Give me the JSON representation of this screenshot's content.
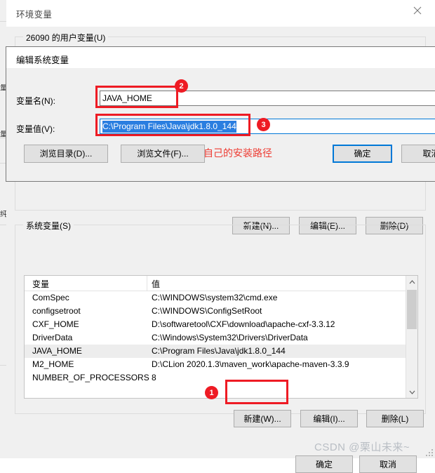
{
  "window": {
    "title": "环境变量",
    "close_icon": "close-icon"
  },
  "user_section": {
    "legend": "26090 的用户变量(U)",
    "buttons": {
      "new": "新建(N)...",
      "edit": "编辑(E)...",
      "delete": "删除(D)"
    }
  },
  "system_section": {
    "legend": "系统变量(S)",
    "columns": [
      "变量",
      "值"
    ],
    "rows": [
      {
        "name": "ComSpec",
        "value": "C:\\WINDOWS\\system32\\cmd.exe",
        "selected": false
      },
      {
        "name": "configsetroot",
        "value": "C:\\WINDOWS\\ConfigSetRoot",
        "selected": false
      },
      {
        "name": "CXF_HOME",
        "value": "D:\\softwaretool\\CXF\\download\\apache-cxf-3.3.12",
        "selected": false
      },
      {
        "name": "DriverData",
        "value": "C:\\Windows\\System32\\Drivers\\DriverData",
        "selected": false
      },
      {
        "name": "JAVA_HOME",
        "value": "C:\\Program Files\\Java\\jdk1.8.0_144",
        "selected": true
      },
      {
        "name": "M2_HOME",
        "value": "D:\\CLion 2020.1.3\\maven_work\\apache-maven-3.3.9",
        "selected": false
      },
      {
        "name": "NUMBER_OF_PROCESSORS",
        "value": "8",
        "selected": false
      }
    ],
    "buttons": {
      "new": "新建(W)...",
      "edit": "编辑(I)...",
      "delete": "删除(L)"
    },
    "scrollbar": {
      "up_icon": "chevron-up-icon",
      "down_icon": "chevron-down-icon"
    }
  },
  "window_buttons": {
    "ok": "确定",
    "cancel": "取消"
  },
  "edit_dialog": {
    "title": "编辑系统变量",
    "name_label": "变量名(N):",
    "name_value": "JAVA_HOME",
    "value_label": "变量值(V):",
    "value_value": "C:\\Program Files\\Java\\jdk1.8.0_144",
    "buttons": {
      "browse_dir": "浏览目录(D)...",
      "browse_file": "浏览文件(F)...",
      "ok": "确定",
      "cancel": "取消"
    }
  },
  "annotations": {
    "badge_1": "1",
    "badge_2": "2",
    "badge_3": "3",
    "note_path": "自己的安装路径",
    "color": "#ee1b24"
  },
  "watermark": "CSDN @栗山未来~"
}
